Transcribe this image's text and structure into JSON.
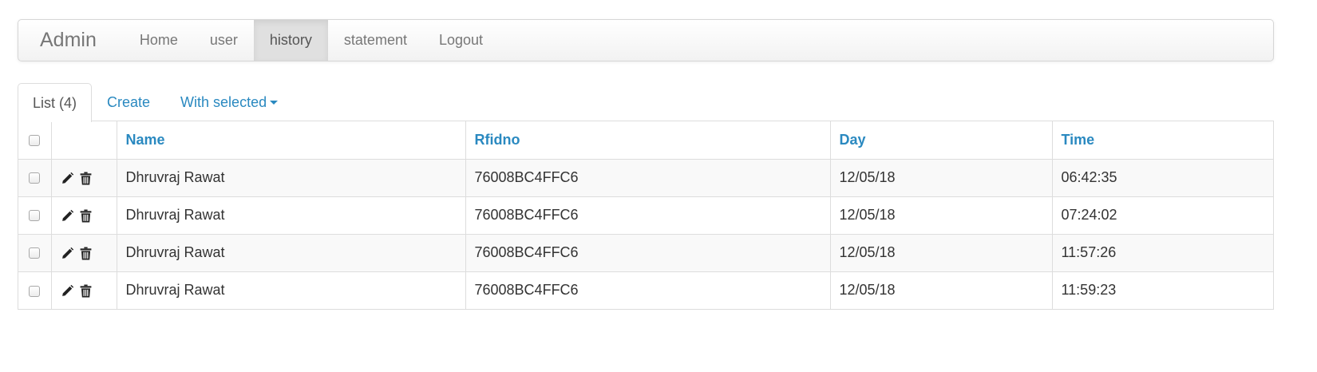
{
  "navbar": {
    "brand": "Admin",
    "links": [
      {
        "label": "Home"
      },
      {
        "label": "user"
      },
      {
        "label": "history"
      },
      {
        "label": "statement"
      },
      {
        "label": "Logout"
      }
    ],
    "active_link": "history"
  },
  "tabs": {
    "list_label": "List (4)",
    "create_label": "Create",
    "with_selected_label": "With selected"
  },
  "table": {
    "columns": [
      "Name",
      "Rfidno",
      "Day",
      "Time"
    ],
    "rows": [
      {
        "name": "Dhruvraj Rawat",
        "rfidno": "76008BC4FFC6",
        "day": "12/05/18",
        "time": "06:42:35"
      },
      {
        "name": "Dhruvraj Rawat",
        "rfidno": "76008BC4FFC6",
        "day": "12/05/18",
        "time": "07:24:02"
      },
      {
        "name": "Dhruvraj Rawat",
        "rfidno": "76008BC4FFC6",
        "day": "12/05/18",
        "time": "11:57:26"
      },
      {
        "name": "Dhruvraj Rawat",
        "rfidno": "76008BC4FFC6",
        "day": "12/05/18",
        "time": "11:59:23"
      }
    ],
    "row_icons": [
      "pencil-icon",
      "trash-icon"
    ]
  },
  "colors": {
    "link": "#2a89c0",
    "muted_text": "#777777",
    "active_nav_bg": "#e0e0e0",
    "border": "#dddddd",
    "stripe": "#f9f9f9"
  }
}
